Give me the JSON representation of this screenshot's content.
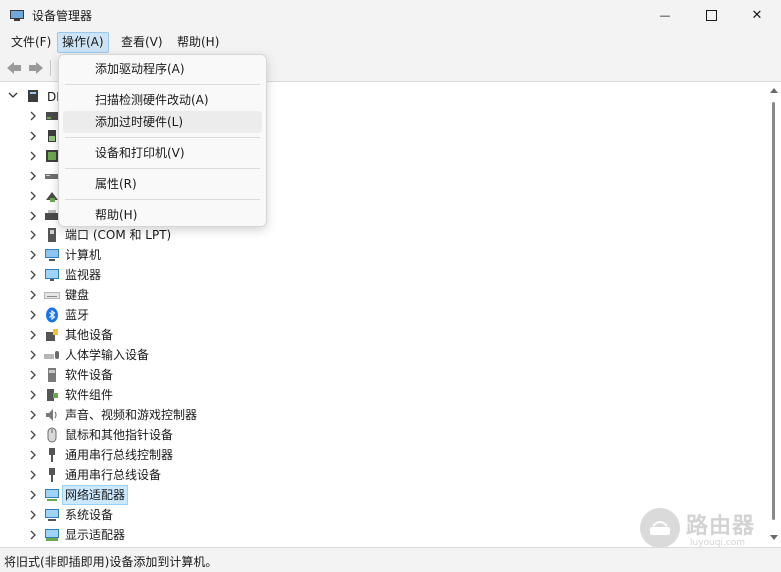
{
  "window": {
    "title": "设备管理器",
    "min_glyph": "—",
    "close_glyph": "✕"
  },
  "menubar": {
    "items": [
      {
        "label": "文件(F)"
      },
      {
        "label": "操作(A)"
      },
      {
        "label": "查看(V)"
      },
      {
        "label": "帮助(H)"
      }
    ]
  },
  "dropdown": {
    "items": [
      {
        "label": "添加驱动程序(A)"
      },
      {
        "label": "扫描检测硬件改动(A)"
      },
      {
        "label": "添加过时硬件(L)"
      },
      {
        "label": "设备和打印机(V)"
      },
      {
        "label": "属性(R)"
      },
      {
        "label": "帮助(H)"
      }
    ]
  },
  "tree": {
    "root_label": "DE",
    "nodes": [
      {
        "label": "端口 (COM 和 LPT)"
      },
      {
        "label": "计算机"
      },
      {
        "label": "监视器"
      },
      {
        "label": "键盘"
      },
      {
        "label": "蓝牙"
      },
      {
        "label": "其他设备"
      },
      {
        "label": "人体学输入设备"
      },
      {
        "label": "软件设备"
      },
      {
        "label": "软件组件"
      },
      {
        "label": "声音、视频和游戏控制器"
      },
      {
        "label": "鼠标和其他指针设备"
      },
      {
        "label": "通用串行总线控制器"
      },
      {
        "label": "通用串行总线设备"
      },
      {
        "label": "网络适配器"
      },
      {
        "label": "系统设备"
      },
      {
        "label": "显示适配器"
      }
    ]
  },
  "statusbar": {
    "text": "将旧式(非即插即用)设备添加到计算机。"
  },
  "watermark": {
    "title": "路由器",
    "url": "luyouqi.com"
  },
  "colors": {
    "menu_active": "#cde4f7",
    "selection": "#cce8ff",
    "chrome": "#f3f3f3"
  }
}
